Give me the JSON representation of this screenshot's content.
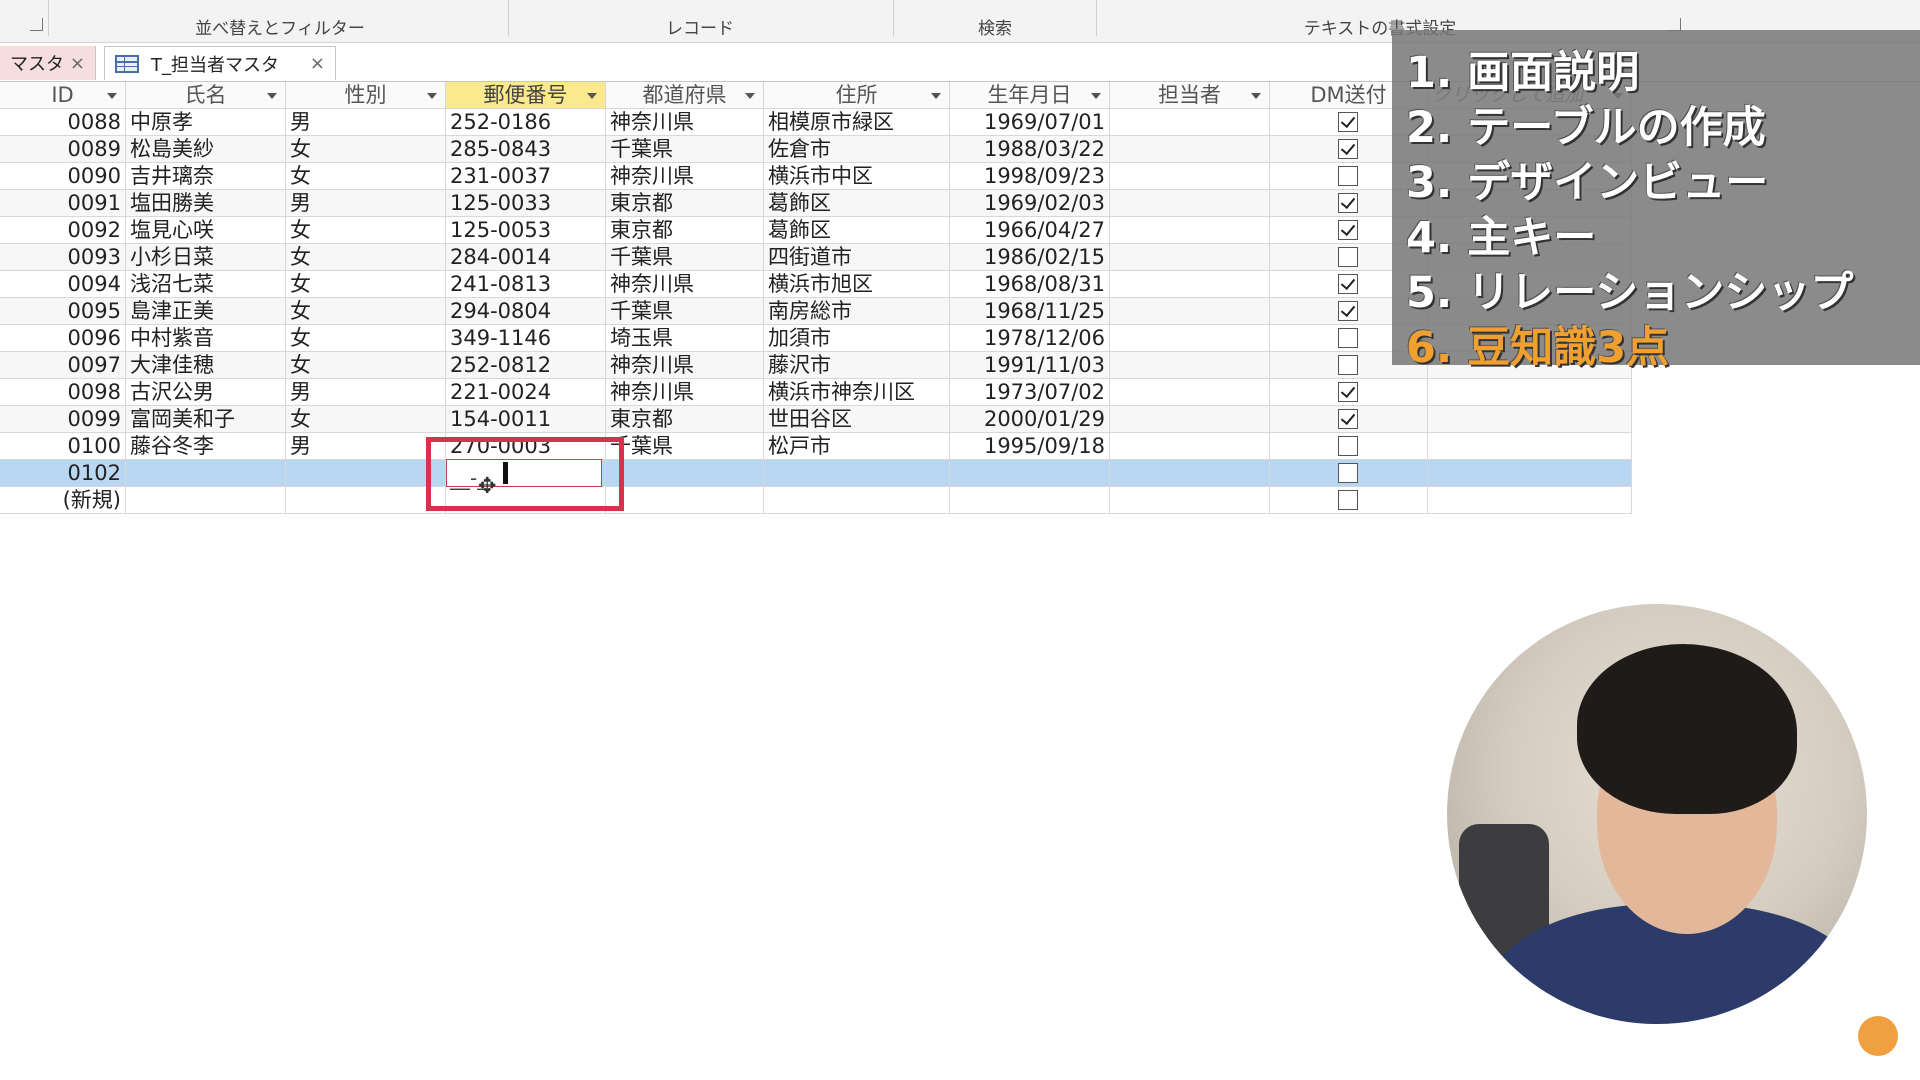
{
  "ribbon": {
    "groups": [
      "並べ替えとフィルター",
      "レコード",
      "検索",
      "テキストの書式設定"
    ]
  },
  "tabs": {
    "inactive_label": "マスタ",
    "active_label": "T_担当者マスタ",
    "close_glyph": "×"
  },
  "columns": [
    {
      "label": "ID",
      "dropdown": true
    },
    {
      "label": "氏名",
      "dropdown": true
    },
    {
      "label": "性別",
      "dropdown": true
    },
    {
      "label": "郵便番号",
      "dropdown": true,
      "selected": true
    },
    {
      "label": "都道府県",
      "dropdown": true
    },
    {
      "label": "住所",
      "dropdown": true
    },
    {
      "label": "生年月日",
      "dropdown": true
    },
    {
      "label": "担当者",
      "dropdown": true
    },
    {
      "label": "DM送付",
      "dropdown": false
    },
    {
      "label": "クリックして追加",
      "dropdown": true,
      "placeholder": true
    }
  ],
  "rows": [
    {
      "id": "0088",
      "name": "中原孝",
      "gender": "男",
      "zip": "252-0186",
      "pref": "神奈川県",
      "addr": "相模原市緑区",
      "birth": "1969/07/01",
      "staff": "",
      "dm": true
    },
    {
      "id": "0089",
      "name": "松島美紗",
      "gender": "女",
      "zip": "285-0843",
      "pref": "千葉県",
      "addr": "佐倉市",
      "birth": "1988/03/22",
      "staff": "",
      "dm": true
    },
    {
      "id": "0090",
      "name": "吉井璃奈",
      "gender": "女",
      "zip": "231-0037",
      "pref": "神奈川県",
      "addr": "横浜市中区",
      "birth": "1998/09/23",
      "staff": "",
      "dm": false
    },
    {
      "id": "0091",
      "name": "塩田勝美",
      "gender": "男",
      "zip": "125-0033",
      "pref": "東京都",
      "addr": "葛飾区",
      "birth": "1969/02/03",
      "staff": "",
      "dm": true
    },
    {
      "id": "0092",
      "name": "塩見心咲",
      "gender": "女",
      "zip": "125-0053",
      "pref": "東京都",
      "addr": "葛飾区",
      "birth": "1966/04/27",
      "staff": "",
      "dm": true
    },
    {
      "id": "0093",
      "name": "小杉日菜",
      "gender": "女",
      "zip": "284-0014",
      "pref": "千葉県",
      "addr": "四街道市",
      "birth": "1986/02/15",
      "staff": "",
      "dm": false
    },
    {
      "id": "0094",
      "name": "浅沼七菜",
      "gender": "女",
      "zip": "241-0813",
      "pref": "神奈川県",
      "addr": "横浜市旭区",
      "birth": "1968/08/31",
      "staff": "",
      "dm": true
    },
    {
      "id": "0095",
      "name": "島津正美",
      "gender": "女",
      "zip": "294-0804",
      "pref": "千葉県",
      "addr": "南房総市",
      "birth": "1968/11/25",
      "staff": "",
      "dm": true
    },
    {
      "id": "0096",
      "name": "中村紫音",
      "gender": "女",
      "zip": "349-1146",
      "pref": "埼玉県",
      "addr": "加須市",
      "birth": "1978/12/06",
      "staff": "",
      "dm": false
    },
    {
      "id": "0097",
      "name": "大津佳穂",
      "gender": "女",
      "zip": "252-0812",
      "pref": "神奈川県",
      "addr": "藤沢市",
      "birth": "1991/11/03",
      "staff": "",
      "dm": false
    },
    {
      "id": "0098",
      "name": "古沢公男",
      "gender": "男",
      "zip": "221-0024",
      "pref": "神奈川県",
      "addr": "横浜市神奈川区",
      "birth": "1973/07/02",
      "staff": "",
      "dm": true
    },
    {
      "id": "0099",
      "name": "富岡美和子",
      "gender": "女",
      "zip": "154-0011",
      "pref": "東京都",
      "addr": "世田谷区",
      "birth": "2000/01/29",
      "staff": "",
      "dm": true
    },
    {
      "id": "0100",
      "name": "藤谷冬李",
      "gender": "男",
      "zip": "270-0003",
      "pref": "千葉県",
      "addr": "松戸市",
      "birth": "1995/09/18",
      "staff": "",
      "dm": false
    },
    {
      "id": "0102",
      "name": "",
      "gender": "",
      "zip": "",
      "pref": "",
      "addr": "",
      "birth": "",
      "staff": "",
      "dm": false,
      "current": true
    },
    {
      "id": "(新規)",
      "name": "",
      "gender": "",
      "zip": "",
      "pref": "",
      "addr": "",
      "birth": "",
      "staff": "",
      "dm": false
    }
  ],
  "editing": {
    "mask_text": "__-_"
  },
  "chapters": [
    {
      "label": "1. 画面説明",
      "active": false
    },
    {
      "label": "2. テーブルの作成",
      "active": false
    },
    {
      "label": "3. デザインビュー",
      "active": false
    },
    {
      "label": "4. 主キー",
      "active": false
    },
    {
      "label": "5. リレーションシップ",
      "active": false
    },
    {
      "label": "6. 豆知識3点",
      "active": true
    }
  ],
  "colors": {
    "selected_header": "#fbe98e",
    "current_row": "#b9d6f2",
    "focus_box": "#d6324c",
    "active_chapter": "#f0a030"
  }
}
